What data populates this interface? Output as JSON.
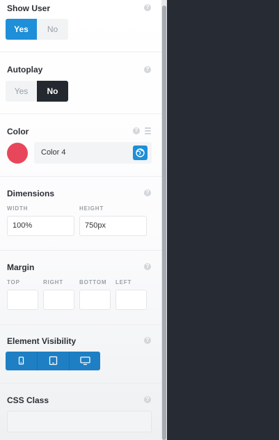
{
  "show_user": {
    "label": "Show User",
    "options": [
      "Yes",
      "No"
    ],
    "selected": "Yes"
  },
  "autoplay": {
    "label": "Autoplay",
    "options": [
      "Yes",
      "No"
    ],
    "selected": "No"
  },
  "color": {
    "label": "Color",
    "value": "Color 4",
    "swatch": "#e8475b"
  },
  "dimensions": {
    "label": "Dimensions",
    "width_label": "WIDTH",
    "width_value": "100%",
    "height_label": "HEIGHT",
    "height_value": "750px"
  },
  "margin": {
    "label": "Margin",
    "sides": [
      "TOP",
      "RIGHT",
      "BOTTOM",
      "LEFT"
    ]
  },
  "visibility": {
    "label": "Element Visibility",
    "devices": [
      "mobile-icon",
      "tablet-icon",
      "desktop-icon"
    ]
  },
  "css_class": {
    "label": "CSS Class",
    "value": ""
  },
  "help_glyph": "?",
  "accent": "#1e8fd8"
}
